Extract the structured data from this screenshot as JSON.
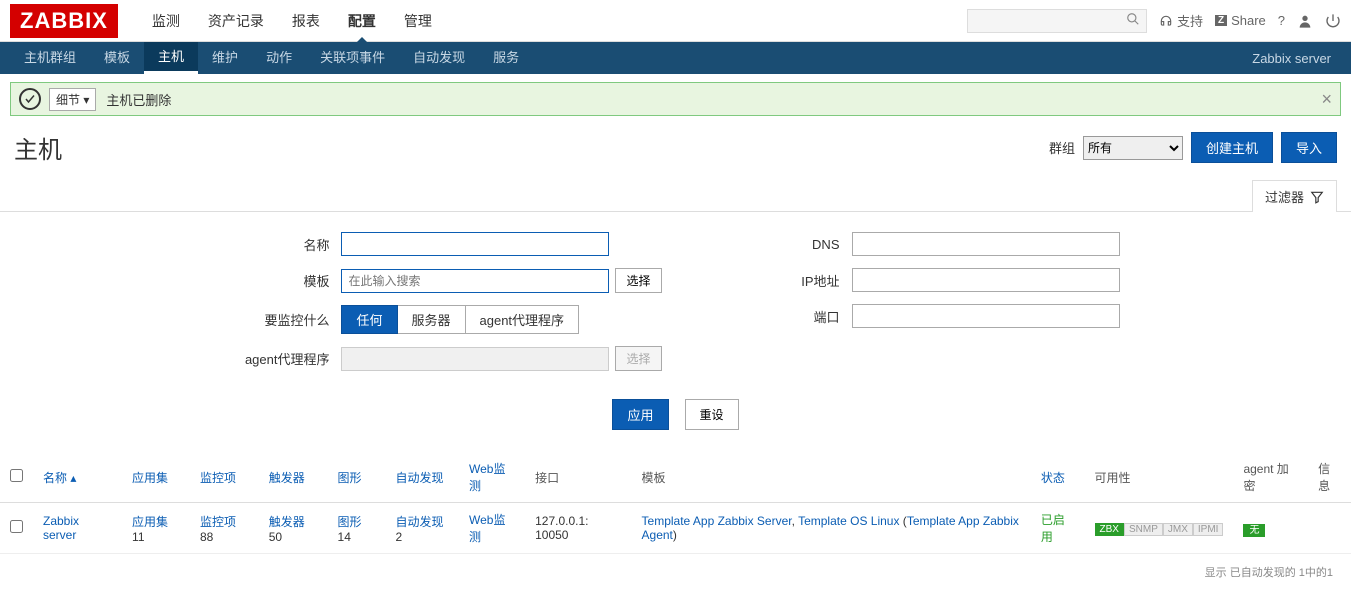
{
  "logo": "ZABBIX",
  "main_nav": [
    "监测",
    "资产记录",
    "报表",
    "配置",
    "管理"
  ],
  "main_nav_active": 3,
  "top_right": {
    "support": "支持",
    "share": "Share"
  },
  "sub_nav": [
    "主机群组",
    "模板",
    "主机",
    "维护",
    "动作",
    "关联项事件",
    "自动发现",
    "服务"
  ],
  "sub_nav_active": 2,
  "sub_nav_right": "Zabbix server",
  "message": {
    "detail": "细节 ▾",
    "text": "主机已删除"
  },
  "page": {
    "title": "主机",
    "group_label": "群组",
    "group_value": "所有",
    "create": "创建主机",
    "import": "导入"
  },
  "filter_tab": "过滤器",
  "filter": {
    "name_label": "名称",
    "template_label": "模板",
    "template_placeholder": "在此输入搜索",
    "select_btn": "选择",
    "monitor_label": "要监控什么",
    "monitor_options": [
      "任何",
      "服务器",
      "agent代理程序"
    ],
    "monitor_active": 0,
    "agent_label": "agent代理程序",
    "dns_label": "DNS",
    "ip_label": "IP地址",
    "port_label": "端口",
    "apply": "应用",
    "reset": "重设"
  },
  "columns": {
    "name": "名称",
    "app": "应用集",
    "items": "监控项",
    "triggers": "触发器",
    "graphs": "图形",
    "discovery": "自动发现",
    "web": "Web监测",
    "interface": "接口",
    "template": "模板",
    "status": "状态",
    "availability": "可用性",
    "agent_enc": "agent 加密",
    "info": "信息"
  },
  "row": {
    "name": "Zabbix server",
    "app_label": "应用集",
    "app_count": "11",
    "items_label": "监控项",
    "items_count": "88",
    "triggers_label": "触发器",
    "triggers_count": "50",
    "graphs_label": "图形",
    "graphs_count": "14",
    "discovery_label": "自动发现",
    "discovery_count": "2",
    "web_label": "Web监测",
    "interface": "127.0.0.1: 10050",
    "tpl1": "Template App Zabbix Server",
    "tpl_sep": ", ",
    "tpl2": "Template OS Linux",
    "tpl_paren_open": " (",
    "tpl3": "Template App Zabbix Agent",
    "tpl_paren_close": ")",
    "status": "已启用",
    "avail": {
      "zbx": "ZBX",
      "snmp": "SNMP",
      "jmx": "JMX",
      "ipmi": "IPMI"
    },
    "enc": "无"
  },
  "footer": "显示 已自动发现的 1中的1"
}
